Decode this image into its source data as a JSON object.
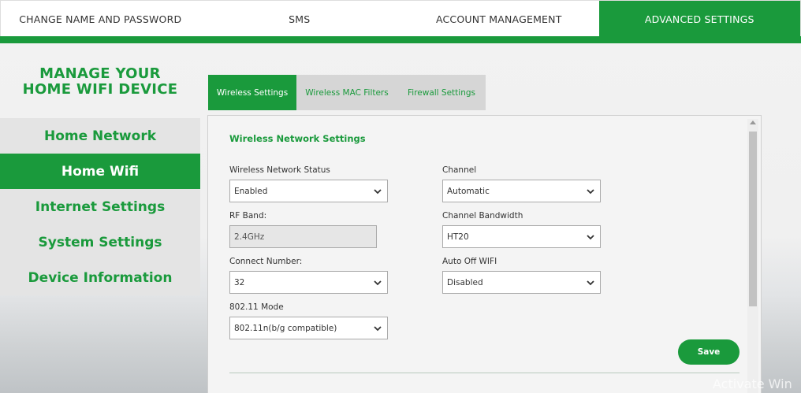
{
  "topnav": {
    "tabs": [
      {
        "label": "CHANGE NAME AND PASSWORD"
      },
      {
        "label": "SMS"
      },
      {
        "label": "ACCOUNT MANAGEMENT"
      },
      {
        "label": "ADVANCED SETTINGS",
        "active": true
      }
    ]
  },
  "brand": {
    "line1": "MANAGE YOUR",
    "line2": "HOME WIFI DEVICE"
  },
  "sidebar": {
    "items": [
      {
        "label": "Home Network"
      },
      {
        "label": "Home Wifi",
        "active": true
      },
      {
        "label": "Internet Settings"
      },
      {
        "label": "System Settings"
      },
      {
        "label": "Device Information"
      }
    ]
  },
  "subtabs": [
    {
      "label": "Wireless Settings",
      "active": true
    },
    {
      "label": "Wireless MAC Filters"
    },
    {
      "label": "Firewall Settings"
    }
  ],
  "panel": {
    "title": "Wireless Network Settings",
    "fields": {
      "wireless_status": {
        "label": "Wireless Network Status",
        "value": "Enabled"
      },
      "rf_band": {
        "label": "RF Band:",
        "value": "2.4GHz"
      },
      "connect_number": {
        "label": "Connect Number:",
        "value": "32"
      },
      "mode": {
        "label": "802.11 Mode",
        "value": "802.11n(b/g compatible)"
      },
      "channel": {
        "label": "Channel",
        "value": "Automatic"
      },
      "bandwidth": {
        "label": "Channel Bandwidth",
        "value": "HT20"
      },
      "auto_off": {
        "label": "Auto Off WIFI",
        "value": "Disabled"
      }
    },
    "save_label": "Save"
  },
  "watermark": "Activate Win",
  "colors": {
    "accent": "#1a9a3c"
  },
  "icons": {
    "dropdown": "chevron-down-icon",
    "scroll_up": "arrow-up-icon"
  }
}
